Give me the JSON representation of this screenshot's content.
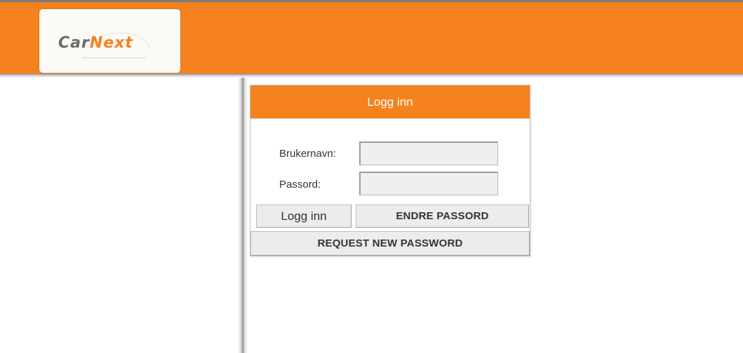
{
  "header": {
    "logo": {
      "text_part1": "Car",
      "text_part2": "Next",
      "brand_color": "#f5821f",
      "text_color": "#6b6b6b"
    },
    "bar_color": "#f5821f"
  },
  "login": {
    "title": "Logg inn",
    "username_label": "Brukernavn:",
    "username_value": "",
    "password_label": "Passord:",
    "password_value": "",
    "login_button": "Logg inn",
    "change_password_button": "ENDRE PASSORD",
    "request_password_button": "REQUEST NEW PASSWORD"
  }
}
